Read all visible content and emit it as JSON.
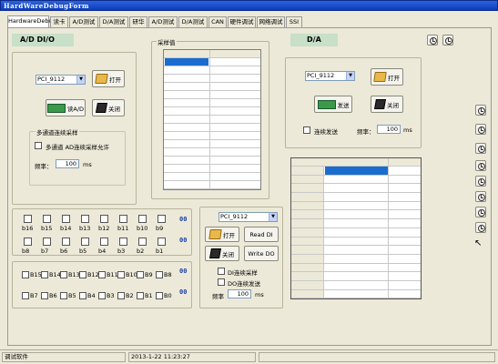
{
  "window": {
    "title": "HardWareDebugForm"
  },
  "tabs": [
    {
      "label": "HardwareDebug"
    },
    {
      "label": "读卡"
    },
    {
      "label": "A/D测试"
    },
    {
      "label": "D/A测试"
    },
    {
      "label": "研华"
    },
    {
      "label": "A/D测试"
    },
    {
      "label": "D/A测试"
    },
    {
      "label": "CAN"
    },
    {
      "label": "硬件调试"
    },
    {
      "label": "网络调试"
    },
    {
      "label": "SSI"
    }
  ],
  "ad": {
    "header": "A/D   DI/O",
    "device": "PCI_9112",
    "open_label": "打开",
    "read_label": "读A/D",
    "close_label": "关闭",
    "group_title": "多通道连续采样",
    "continuous_label": "多通道 AD连续采样允许",
    "freq_label": "频率：",
    "freq_value": "100",
    "freq_unit": "ms"
  },
  "sample": {
    "title": "采样值"
  },
  "da": {
    "header": "D/A",
    "device": "PCI_9112",
    "open_label": "打开",
    "send_label": "发送",
    "close_label": "关闭",
    "continuous_label": "连续发送",
    "freq_label": "频率：",
    "freq_value": "100",
    "freq_unit": "ms"
  },
  "bits_top": {
    "row1": [
      "b16",
      "b15",
      "b14",
      "b13",
      "b12",
      "b11",
      "b10",
      "b9"
    ],
    "row2": [
      "b8",
      "b7",
      "b6",
      "b5",
      "b4",
      "b3",
      "b2",
      "b1"
    ],
    "led1": "00",
    "led2": "00"
  },
  "bits_bottom": {
    "row1": [
      "B15",
      "B14",
      "B13",
      "B12",
      "B11",
      "B10",
      "B9",
      "B8"
    ],
    "row2": [
      "B7",
      "B6",
      "B5",
      "B4",
      "B3",
      "B2",
      "B1",
      "B0"
    ],
    "led1": "00",
    "led2": "00"
  },
  "dio": {
    "device": "PCI_9112",
    "open_label": "打开",
    "read_di_label": "Read DI",
    "close_label": "关闭",
    "write_do_label": "Write DO",
    "di_continuous_label": "DI连续采样",
    "do_continuous_label": "DO连续发送",
    "freq_label": "频率",
    "freq_value": "100",
    "freq_unit": "ms"
  },
  "status": {
    "app": "调试软件",
    "datetime": "2013-1-22 11:23:27"
  }
}
